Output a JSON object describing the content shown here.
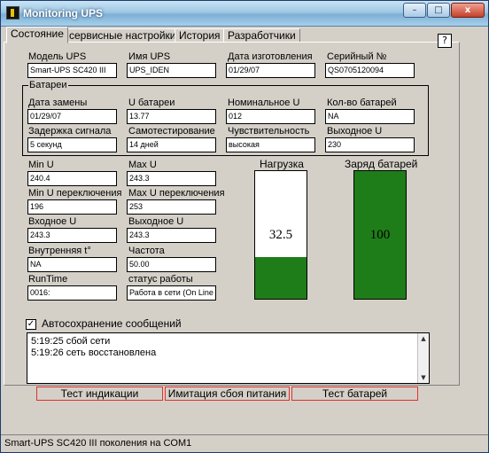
{
  "window": {
    "title": "Monitoring UPS",
    "min_glyph": "–",
    "max_glyph": "□",
    "close_glyph": "x"
  },
  "tabs": [
    {
      "label": "Состояние"
    },
    {
      "label": "сервисные настройки"
    },
    {
      "label": "История"
    },
    {
      "label": "Разработчики"
    }
  ],
  "help_label": "?",
  "info": {
    "model_label": "Модель UPS",
    "model_value": "Smart-UPS SC420 III",
    "name_label": "Имя UPS",
    "name_value": "UPS_IDEN",
    "mfg_date_label": "Дата изготовления",
    "mfg_date_value": "01/29/07",
    "serial_label": "Серийный №",
    "serial_value": "QS0705120094"
  },
  "battery": {
    "group_title": "Батареи",
    "replace_date_label": "Дата замены",
    "replace_date_value": "01/29/07",
    "voltage_label": "U батареи",
    "voltage_value": "13.77",
    "nominal_label": "Номинальное U",
    "nominal_value": "012",
    "count_label": "Кол-во батарей",
    "count_value": "NA",
    "signal_delay_label": "Задержка сигнала",
    "signal_delay_value": "5 секунд",
    "selftest_label": "Самотестирование",
    "selftest_value": "14 дней",
    "sensitivity_label": "Чувствительность",
    "sensitivity_value": "высокая",
    "output_label": "Выходное U",
    "output_value": "230"
  },
  "readings": {
    "min_u_label": "Min U",
    "min_u_value": "240.4",
    "max_u_label": "Max U",
    "max_u_value": "243.3",
    "min_switch_label": "Min U переключения",
    "min_switch_value": "196",
    "max_switch_label": "Max U переключения",
    "max_switch_value": "253",
    "input_label": "Входное U",
    "input_value": "243.3",
    "output_u_label": "Выходное U",
    "output_u_value": "243.3",
    "temp_label": "Внутренняя t°",
    "temp_value": "NA",
    "freq_label": "Частота",
    "freq_value": "50.00",
    "runtime_label": "RunTime",
    "runtime_value": "0016:",
    "status_label": "статус работы",
    "status_value": "Работа в сети (On Line"
  },
  "meters": {
    "load_title": "Нагрузка",
    "load_value": "32.5",
    "load_fraction": 0.325,
    "charge_title": "Заряд батарей",
    "charge_value": "100",
    "charge_fraction": 1.0,
    "fill_color": "#1f7d19"
  },
  "autosave": {
    "checked_glyph": "✓",
    "label": "Автосохранение сообщений"
  },
  "log": [
    "5:19:25 сбой сети",
    "5:19:26 сеть восстановлена"
  ],
  "buttons": {
    "test_indication": "Тест индикации",
    "simulate_failure": "Имитация сбоя питания",
    "test_battery": "Тест батарей"
  },
  "statusbar": "Smart-UPS SC420 III поколения на COM1"
}
